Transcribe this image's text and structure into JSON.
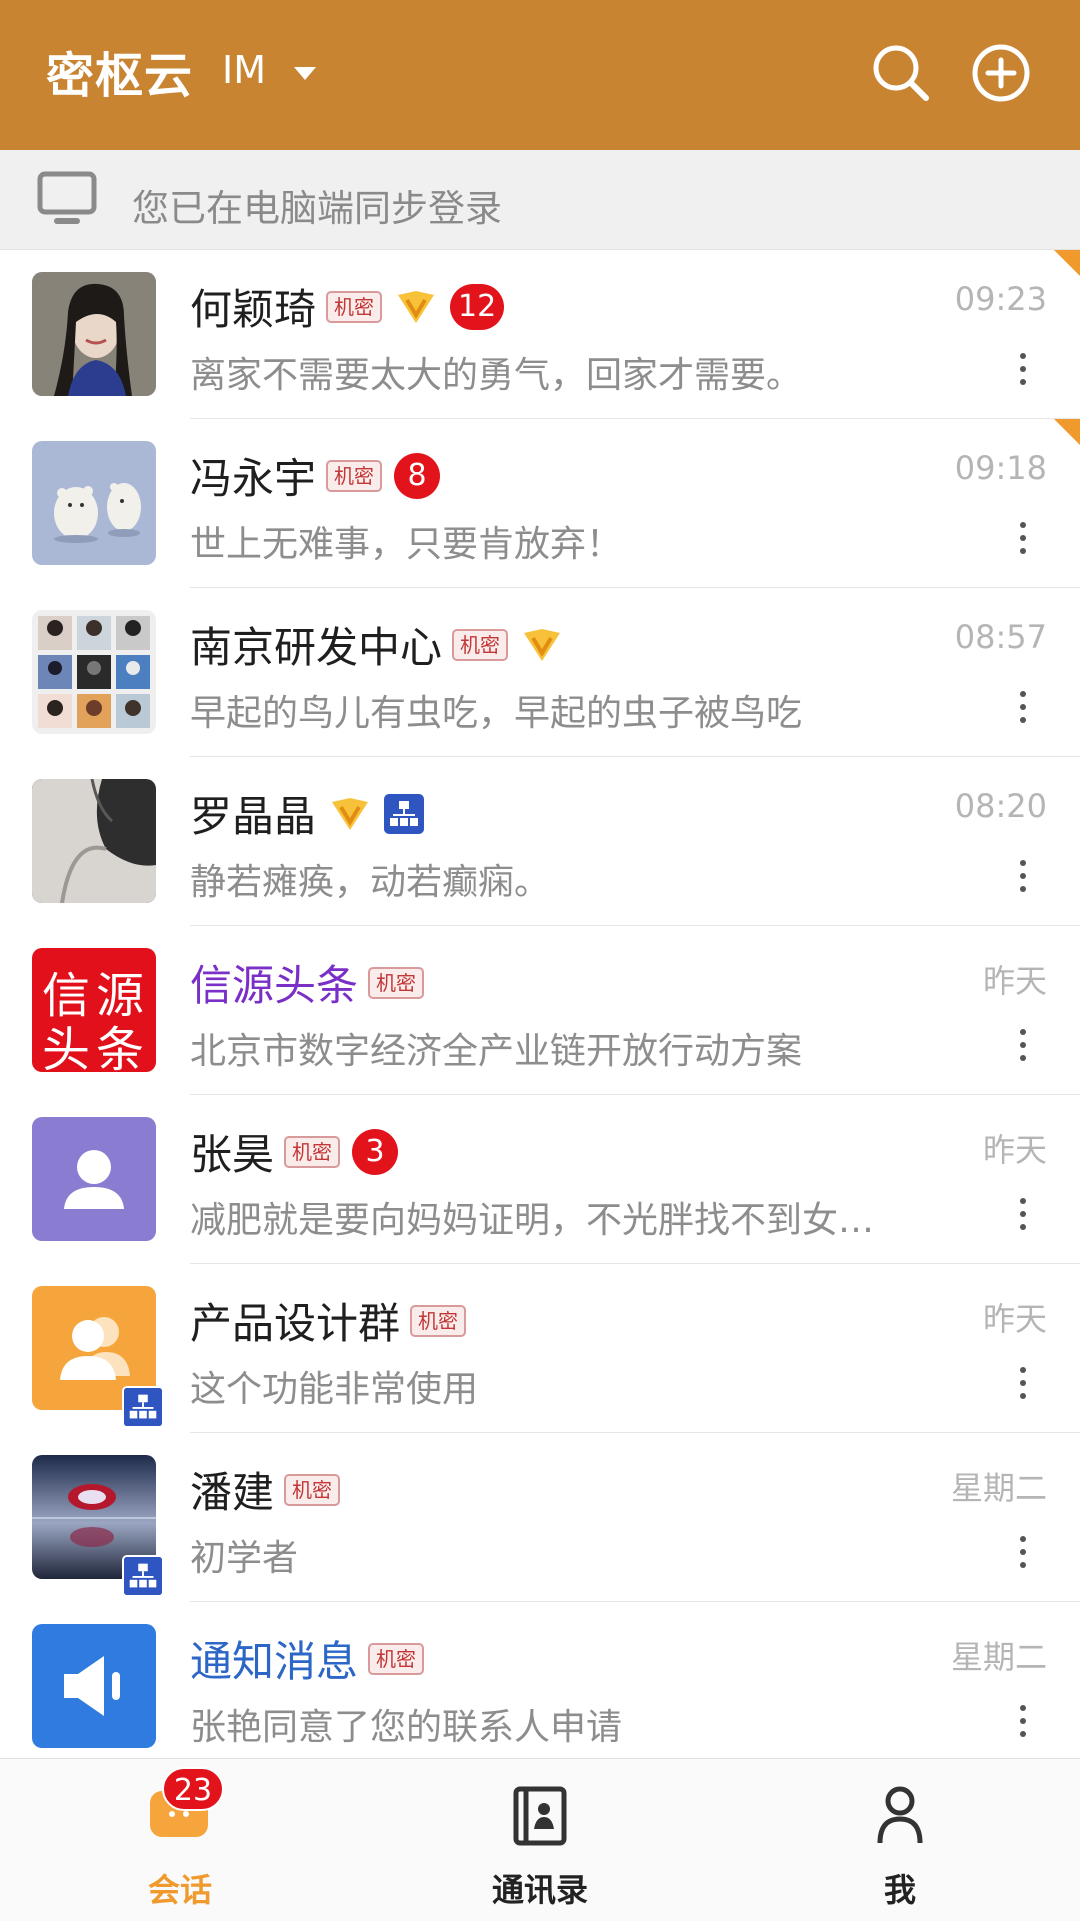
{
  "header": {
    "title": "密枢云",
    "subtitle": "IM",
    "accent": "#c98432"
  },
  "notice": {
    "text": "您已在电脑端同步登录"
  },
  "tag_secret_label": "机密",
  "conversations": [
    {
      "name": "何颖琦",
      "secret": true,
      "vip": true,
      "org": false,
      "unread": "12",
      "time": "09:23",
      "preview": "离家不需要太大的勇气，回家才需要。",
      "pinned": true,
      "avatar": "photo-woman"
    },
    {
      "name": "冯永宇",
      "secret": true,
      "vip": false,
      "org": false,
      "unread": "8",
      "time": "09:18",
      "preview": "世上无难事，只要肯放弃！",
      "pinned": true,
      "avatar": "polar-bears"
    },
    {
      "name": "南京研发中心",
      "secret": true,
      "vip": true,
      "org": false,
      "unread": "",
      "time": "08:57",
      "preview": "早起的鸟儿有虫吃，早起的虫子被鸟吃",
      "pinned": false,
      "avatar": "group-grid"
    },
    {
      "name": "罗晶晶",
      "secret": false,
      "vip": true,
      "org": true,
      "unread": "",
      "time": "08:20",
      "preview": "静若瘫痪，动若癫痫。",
      "pinned": false,
      "avatar": "photo-shoulder"
    },
    {
      "name": "信源头条",
      "secret": true,
      "vip": false,
      "org": false,
      "unread": "",
      "time": "昨天",
      "preview": "北京市数字经济全产业链开放行动方案",
      "pinned": false,
      "avatar": "xinyuan-logo",
      "avatar_text": [
        "信",
        "源",
        "头",
        "条"
      ],
      "color": "purple"
    },
    {
      "name": "张昊",
      "secret": true,
      "vip": false,
      "org": false,
      "unread": "3",
      "time": "昨天",
      "preview": "减肥就是要向妈妈证明，不光胖找不到女…",
      "pinned": false,
      "avatar": "person-placeholder"
    },
    {
      "name": "产品设计群",
      "secret": true,
      "vip": false,
      "org": false,
      "unread": "",
      "time": "昨天",
      "preview": "这个功能非常使用",
      "pinned": false,
      "avatar": "group-placeholder",
      "avatar_org": true
    },
    {
      "name": "潘建",
      "secret": true,
      "vip": false,
      "org": false,
      "unread": "",
      "time": "星期二",
      "preview": "初学者",
      "pinned": false,
      "avatar": "photo-tree",
      "avatar_org": true
    },
    {
      "name": "通知消息",
      "secret": true,
      "vip": false,
      "org": false,
      "unread": "",
      "time": "星期二",
      "preview": "张艳同意了您的联系人申请",
      "pinned": false,
      "avatar": "speaker",
      "color": "blue"
    }
  ],
  "tabs": [
    {
      "label": "会话",
      "badge": "23",
      "active": true,
      "icon": "chat-icon"
    },
    {
      "label": "通讯录",
      "badge": "",
      "active": false,
      "icon": "contacts-icon"
    },
    {
      "label": "我",
      "badge": "",
      "active": false,
      "icon": "person-icon"
    }
  ]
}
